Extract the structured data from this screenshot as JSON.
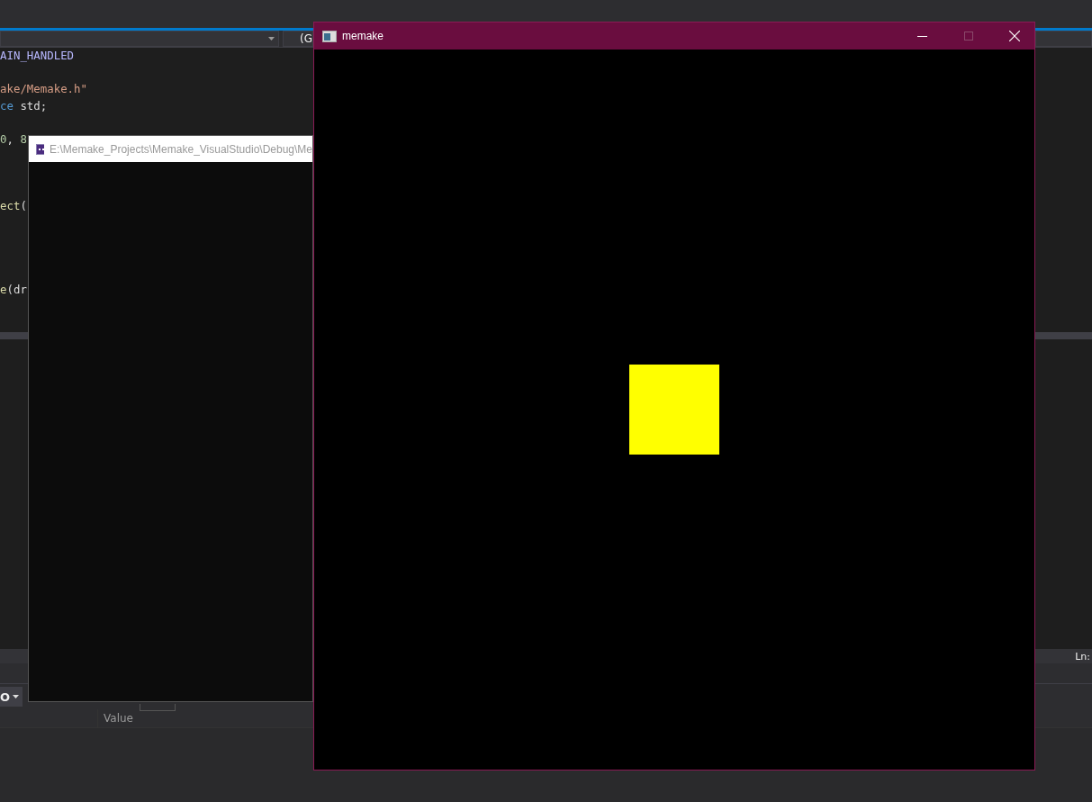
{
  "ide": {
    "scope_dropdown": {
      "value": "(G"
    },
    "code_lines": [
      {
        "kind": "code",
        "segments": [
          {
            "text": "AIN_HANDLED",
            "kind": "macro"
          }
        ]
      },
      {
        "kind": "blank"
      },
      {
        "kind": "code",
        "segments": [
          {
            "text": "ake/Memake.h\"",
            "kind": "string"
          }
        ]
      },
      {
        "kind": "code",
        "segments": [
          {
            "text": "ce",
            "kind": "keyword"
          },
          {
            "text": " std;",
            "kind": "plain"
          }
        ]
      },
      {
        "kind": "blank"
      },
      {
        "kind": "code",
        "segments": [
          {
            "text": "0",
            "kind": "number"
          },
          {
            "text": ", ",
            "kind": "plain"
          },
          {
            "text": "8",
            "kind": "number"
          }
        ]
      },
      {
        "kind": "blank"
      },
      {
        "kind": "blank"
      },
      {
        "kind": "blank"
      },
      {
        "kind": "code",
        "segments": [
          {
            "text": "ect",
            "kind": "function"
          },
          {
            "text": "(",
            "kind": "plain"
          }
        ]
      },
      {
        "kind": "blank"
      },
      {
        "kind": "blank"
      },
      {
        "kind": "blank"
      },
      {
        "kind": "blank"
      },
      {
        "kind": "code",
        "segments": [
          {
            "text": "e",
            "kind": "function"
          },
          {
            "text": "(dr",
            "kind": "plain"
          }
        ]
      }
    ],
    "status_bar": {
      "position": "Ln:"
    },
    "bottom_panel": {
      "toolbar_value": "O",
      "columns": [
        "Value"
      ]
    }
  },
  "console_window": {
    "title": "E:\\Memake_Projects\\Memake_VisualStudio\\Debug\\Me"
  },
  "app_window": {
    "title": "memake",
    "maximize_disabled": true,
    "square": {
      "color": "#ffff00"
    }
  }
}
